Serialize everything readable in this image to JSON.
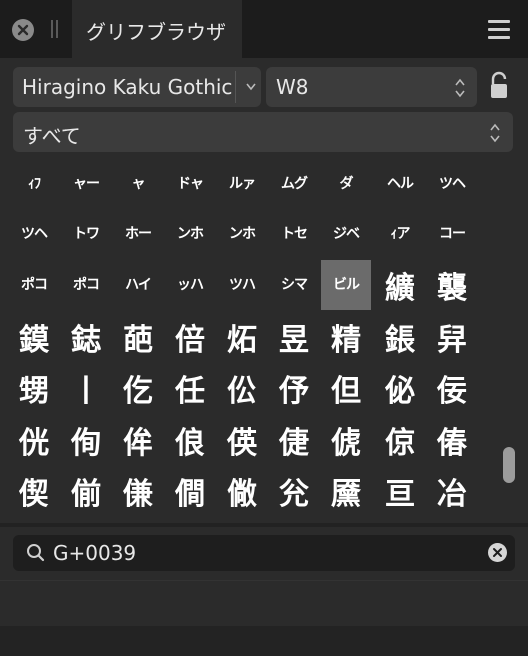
{
  "header": {
    "tab_title": "グリフブラウザ",
    "icons": [
      "close-icon",
      "grip-icon",
      "hamburger-menu-icon"
    ]
  },
  "controls": {
    "font_family": "Hiragino Kaku Gothic",
    "font_weight": "W8",
    "category": "すべて",
    "icons": [
      "chevron-down-icon",
      "stepper-icon",
      "lock-icon"
    ]
  },
  "glyph_grid": {
    "rows": [
      [
        "ｨﾌ",
        "ャー",
        "ャ",
        "ドャ",
        "ルァ",
        "ムグ",
        "ダ",
        "ヘル",
        "ツヘ"
      ],
      [
        "ツヘ",
        "トワ",
        "ホー",
        "ンホ",
        "ンホ",
        "トセ",
        "ジベ",
        "ｨア",
        "コー"
      ],
      [
        "ポコ",
        "ポコ",
        "ハイ",
        "ッハ",
        "ツハ",
        "シマ",
        "ビル",
        "纊",
        "襲"
      ],
      [
        "鏌",
        "鋕",
        "葩",
        "倍",
        "炻",
        "昱",
        "精",
        "鋹",
        "舁"
      ],
      [
        "甥",
        "丨",
        "仡",
        "任",
        "伀",
        "伃",
        "但",
        "佖",
        "佞"
      ],
      [
        "侊",
        "侚",
        "侔",
        "俍",
        "偀",
        "倢",
        "俿",
        "倞",
        "偆"
      ],
      [
        "偰",
        "偂",
        "傔",
        "僴",
        "僘",
        "兊",
        "黡",
        "亘",
        "冶"
      ]
    ],
    "small_rows": 3,
    "selected": "ビル"
  },
  "search": {
    "value": "G+0039",
    "icons": [
      "search-icon",
      "clear-icon"
    ]
  }
}
